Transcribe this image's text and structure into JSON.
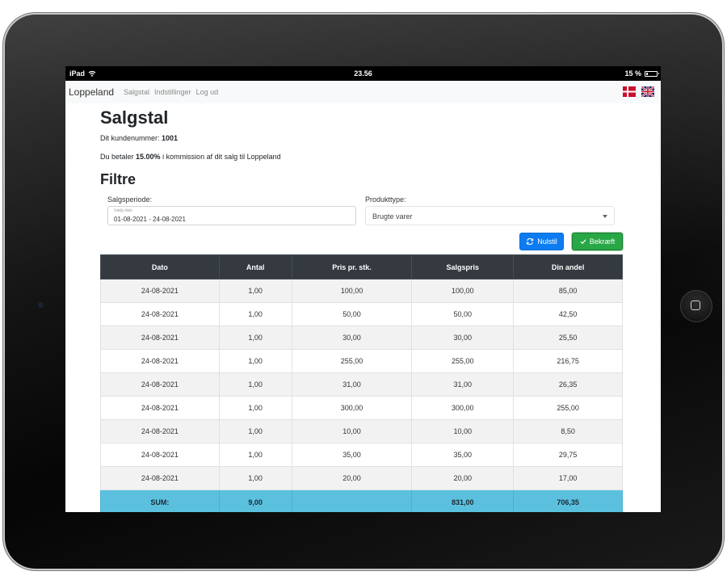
{
  "status_bar": {
    "device": "iPad",
    "time": "23.56",
    "battery": "15 %"
  },
  "nav": {
    "brand": "Loppeland",
    "links": [
      "Salgstal",
      "Indstillinger",
      "Log ud"
    ]
  },
  "page": {
    "title": "Salgstal",
    "customer_prefix": "Dit kundenummer: ",
    "customer_number": "1001",
    "commission_prefix": "Du betaler ",
    "commission_pct": "15.00%",
    "commission_suffix": " i kommission af dit salg til Loppeland"
  },
  "filters": {
    "heading": "Filtre",
    "period_label": "Salgsperiode:",
    "period_placeholder": "Vælg dato",
    "period_value": "01-08-2021 - 24-08-2021",
    "type_label": "Produkttype:",
    "type_value": "Brugte varer",
    "reset_label": "Nulstil",
    "confirm_label": "Bekræft"
  },
  "table": {
    "headers": [
      "Dato",
      "Antal",
      "Pris pr. stk.",
      "Salgspris",
      "Din andel"
    ],
    "rows": [
      [
        "24-08-2021",
        "1,00",
        "100,00",
        "100,00",
        "85,00"
      ],
      [
        "24-08-2021",
        "1,00",
        "50,00",
        "50,00",
        "42,50"
      ],
      [
        "24-08-2021",
        "1,00",
        "30,00",
        "30,00",
        "25,50"
      ],
      [
        "24-08-2021",
        "1,00",
        "255,00",
        "255,00",
        "216,75"
      ],
      [
        "24-08-2021",
        "1,00",
        "31,00",
        "31,00",
        "26,35"
      ],
      [
        "24-08-2021",
        "1,00",
        "300,00",
        "300,00",
        "255,00"
      ],
      [
        "24-08-2021",
        "1,00",
        "10,00",
        "10,00",
        "8,50"
      ],
      [
        "24-08-2021",
        "1,00",
        "35,00",
        "35,00",
        "29,75"
      ],
      [
        "24-08-2021",
        "1,00",
        "20,00",
        "20,00",
        "17,00"
      ]
    ],
    "footer": [
      "SUM:",
      "9,00",
      "",
      "831,00",
      "706,35"
    ]
  },
  "colors": {
    "header_bg": "#343a40",
    "sum_bg": "#5bc0de",
    "reset_btn": "#0d7cf2",
    "confirm_btn": "#28a745"
  },
  "icons": [
    "wifi-icon",
    "battery-icon",
    "danish-flag-icon",
    "uk-flag-icon",
    "refresh-icon",
    "checkmark-icon",
    "home-button-icon"
  ]
}
